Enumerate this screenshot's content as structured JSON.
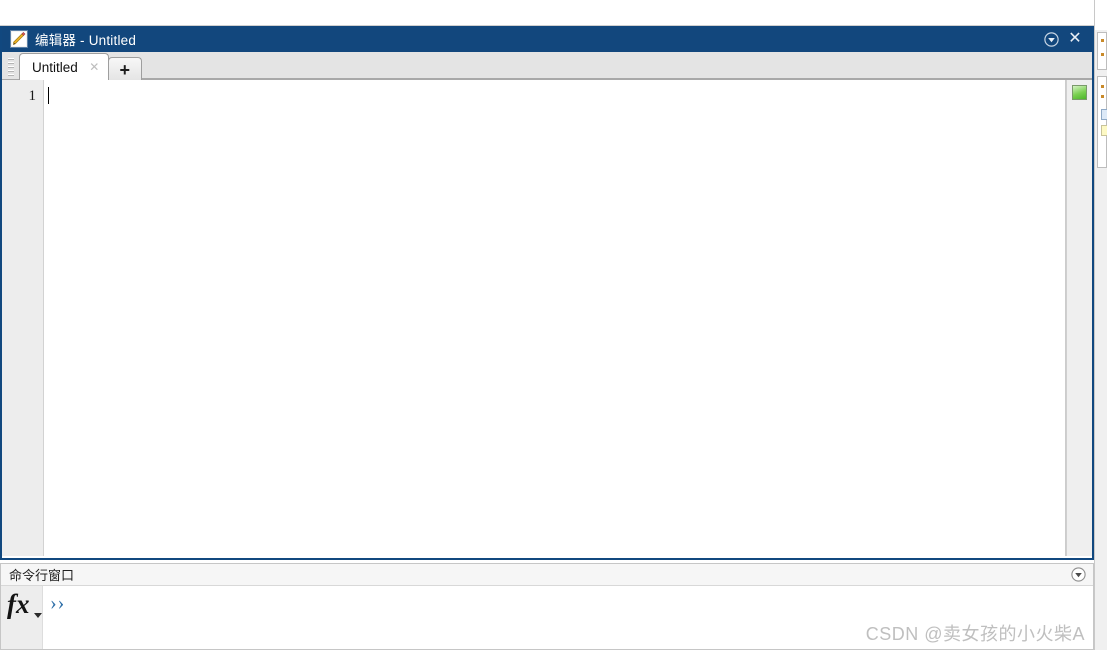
{
  "editor_window": {
    "title": "编辑器 - Untitled",
    "icon": "editor-pencil-icon",
    "titlebar_buttons": {
      "dock_menu": "dock-menu-icon",
      "close": "✕"
    },
    "tabs": [
      {
        "label": "Untitled",
        "close_glyph": "✕",
        "active": true
      }
    ],
    "new_tab_label": "+",
    "gutter": {
      "line_numbers": [
        "1"
      ]
    },
    "code": {
      "content": "",
      "caret_line": 1,
      "caret_column": 1
    },
    "analyzer": {
      "status_color": "#5cc034",
      "status_label": "code-analyzer-ok"
    }
  },
  "command_window": {
    "title": "命令行窗口",
    "menu_icon": "dock-menu-icon",
    "fx_label": "fx",
    "prompt": "››",
    "input_value": ""
  },
  "watermark": {
    "text": "CSDN @卖女孩的小火柴A"
  },
  "colors": {
    "titlebar_bg": "#12477d",
    "window_border": "#11487f",
    "gutter_bg": "#ededed",
    "tabstrip_bg": "#e4e4e4",
    "prompt_blue": "#2f6fa8",
    "analyzer_green": "#5cc034",
    "watermark_gray": "#bfbfbf"
  }
}
